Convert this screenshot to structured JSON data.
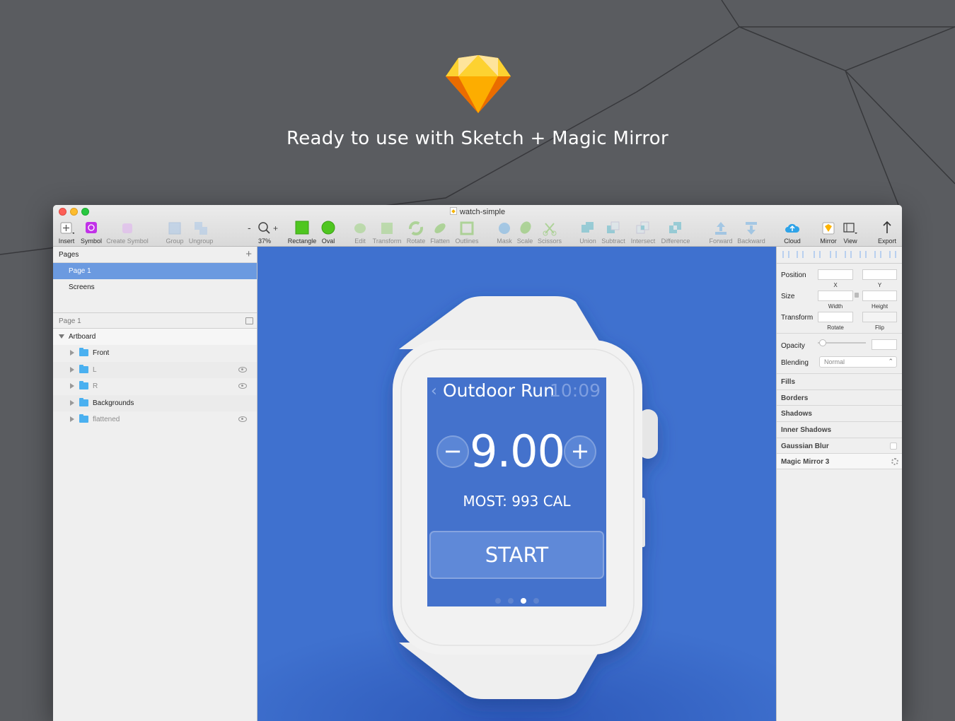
{
  "headline": "Ready to use with Sketch + Magic Mirror",
  "window": {
    "title": "watch-simple"
  },
  "toolbar": {
    "insert": "Insert",
    "symbol": "Symbol",
    "create_symbol": "Create Symbol",
    "group": "Group",
    "ungroup": "Ungroup",
    "zoom_minus": "-",
    "zoom_plus": "+",
    "zoom": "37%",
    "rectangle": "Rectangle",
    "oval": "Oval",
    "edit": "Edit",
    "transform": "Transform",
    "rotate": "Rotate",
    "flatten": "Flatten",
    "outlines": "Outlines",
    "mask": "Mask",
    "scale": "Scale",
    "scissors": "Scissors",
    "union": "Union",
    "subtract": "Subtract",
    "intersect": "Intersect",
    "difference": "Difference",
    "forward": "Forward",
    "backward": "Backward",
    "cloud": "Cloud",
    "mirror": "Mirror",
    "view": "View",
    "export": "Export"
  },
  "pages_panel": {
    "header": "Pages",
    "add": "+",
    "pages": [
      "Page 1",
      "Screens"
    ]
  },
  "layers_panel": {
    "header": "Page 1",
    "artboard": "Artboard",
    "layers": [
      {
        "name": "Front",
        "hidden": false
      },
      {
        "name": "L",
        "hidden": true
      },
      {
        "name": "R",
        "hidden": true
      },
      {
        "name": "Backgrounds",
        "hidden": false
      },
      {
        "name": "flattened",
        "hidden": true
      }
    ]
  },
  "watch_screen": {
    "back": "‹",
    "title": "Outdoor Run",
    "time": "10:09",
    "minus": "−",
    "plus": "+",
    "value": "9.00",
    "most": "MOST: 993 CAL",
    "start": "START",
    "active_page_dot": 3
  },
  "inspector": {
    "position": "Position",
    "x": "X",
    "y": "Y",
    "size": "Size",
    "width": "Width",
    "height": "Height",
    "transform": "Transform",
    "rotate": "Rotate",
    "flip": "Flip",
    "opacity": "Opacity",
    "blending": "Blending",
    "blending_value": "Normal",
    "fills": "Fills",
    "borders": "Borders",
    "shadows": "Shadows",
    "inner_shadows": "Inner Shadows",
    "gaussian_blur": "Gaussian Blur",
    "magic_mirror": "Magic Mirror 3"
  },
  "colors": {
    "canvas": "#3f71cf",
    "watch_screen": "#4472cc",
    "selection": "#6b9ae0",
    "background": "#5a5c60"
  }
}
